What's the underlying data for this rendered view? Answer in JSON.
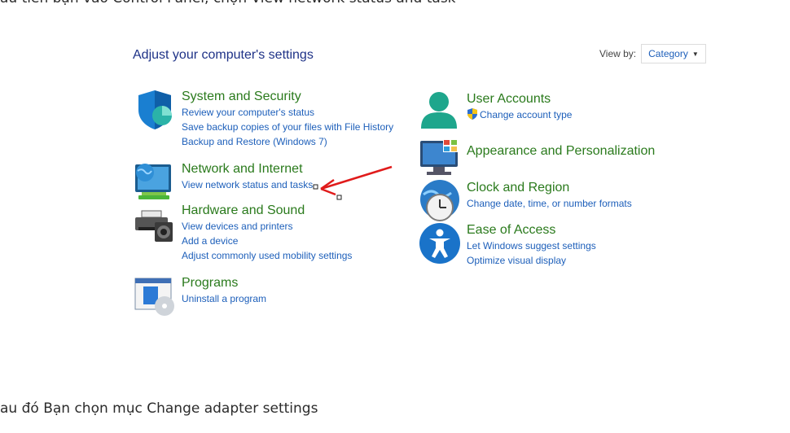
{
  "article": {
    "intro_line": "ầu tiên bạn vào Control Panel, chọn View network status and task",
    "next_line": "au đó Bạn chọn mục Change adapter settings"
  },
  "control_panel": {
    "title": "Adjust your computer's settings",
    "view_by_label": "View by:",
    "view_by_value": "Category",
    "categories_left": [
      {
        "title": "System and Security",
        "icon": "shield-icon",
        "links": [
          "Review your computer's status",
          "Save backup copies of your files with File History",
          "Backup and Restore (Windows 7)"
        ]
      },
      {
        "title": "Network and Internet",
        "icon": "network-globe-icon",
        "links": [
          "View network status and tasks"
        ]
      },
      {
        "title": "Hardware and Sound",
        "icon": "printer-speaker-icon",
        "links": [
          "View devices and printers",
          "Add a device",
          "Adjust commonly used mobility settings"
        ]
      },
      {
        "title": "Programs",
        "icon": "programs-disc-icon",
        "links": [
          "Uninstall a program"
        ]
      }
    ],
    "categories_right": [
      {
        "title": "User Accounts",
        "icon": "user-icon",
        "links": [
          "Change account type"
        ]
      },
      {
        "title": "Appearance and Personalization",
        "icon": "monitor-palette-icon",
        "links": []
      },
      {
        "title": "Clock and Region",
        "icon": "clock-globe-icon",
        "links": [
          "Change date, time, or number formats"
        ]
      },
      {
        "title": "Ease of Access",
        "icon": "accessibility-icon",
        "links": [
          "Let Windows suggest settings",
          "Optimize visual display"
        ]
      }
    ]
  },
  "colors": {
    "category_title": "#2a7a1c",
    "link": "#1d5fba",
    "heading": "#1e3287",
    "annotation_arrow": "#e01b1b"
  }
}
